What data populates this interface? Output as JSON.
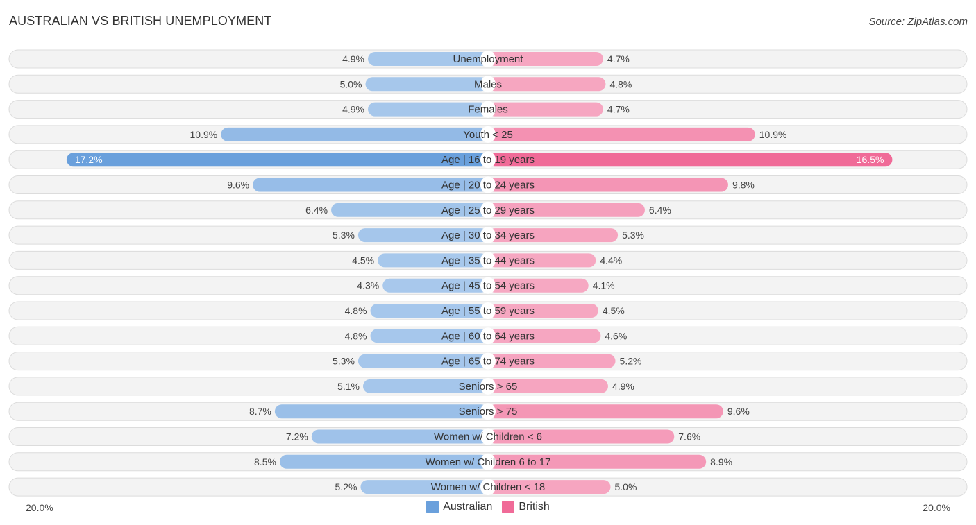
{
  "header": {
    "title": "AUSTRALIAN VS BRITISH UNEMPLOYMENT",
    "source": "Source: ZipAtlas.com"
  },
  "colors": {
    "australian": "#6aa0dc",
    "australian_light": "#a8c8ec",
    "british": "#f06b98",
    "british_light": "#f6a8c2"
  },
  "chart_data": {
    "type": "bar",
    "orientation": "horizontal-diverging",
    "title": "AUSTRALIAN VS BRITISH UNEMPLOYMENT",
    "categories": [
      "Unemployment",
      "Males",
      "Females",
      "Youth < 25",
      "Age | 16 to 19 years",
      "Age | 20 to 24 years",
      "Age | 25 to 29 years",
      "Age | 30 to 34 years",
      "Age | 35 to 44 years",
      "Age | 45 to 54 years",
      "Age | 55 to 59 years",
      "Age | 60 to 64 years",
      "Age | 65 to 74 years",
      "Seniors > 65",
      "Seniors > 75",
      "Women w/ Children < 6",
      "Women w/ Children 6 to 17",
      "Women w/ Children < 18"
    ],
    "series": [
      {
        "name": "Australian",
        "side": "left",
        "values": [
          4.9,
          5.0,
          4.9,
          10.9,
          17.2,
          9.6,
          6.4,
          5.3,
          4.5,
          4.3,
          4.8,
          4.8,
          5.3,
          5.1,
          8.7,
          7.2,
          8.5,
          5.2
        ],
        "labels": [
          "4.9%",
          "5.0%",
          "4.9%",
          "10.9%",
          "17.2%",
          "9.6%",
          "6.4%",
          "5.3%",
          "4.5%",
          "4.3%",
          "4.8%",
          "4.8%",
          "5.3%",
          "5.1%",
          "8.7%",
          "7.2%",
          "8.5%",
          "5.2%"
        ]
      },
      {
        "name": "British",
        "side": "right",
        "values": [
          4.7,
          4.8,
          4.7,
          10.9,
          16.5,
          9.8,
          6.4,
          5.3,
          4.4,
          4.1,
          4.5,
          4.6,
          5.2,
          4.9,
          9.6,
          7.6,
          8.9,
          5.0
        ],
        "labels": [
          "4.7%",
          "4.8%",
          "4.7%",
          "10.9%",
          "16.5%",
          "9.8%",
          "6.4%",
          "5.3%",
          "4.4%",
          "4.1%",
          "4.5%",
          "4.6%",
          "5.2%",
          "4.9%",
          "9.6%",
          "7.6%",
          "8.9%",
          "5.0%"
        ]
      }
    ],
    "axis": {
      "min_label": "20.0%",
      "max_label": "20.0%",
      "range": [
        0,
        20
      ],
      "unit": "%"
    },
    "legend": {
      "position": "bottom-center",
      "items": [
        "Australian",
        "British"
      ]
    },
    "grid": false
  }
}
